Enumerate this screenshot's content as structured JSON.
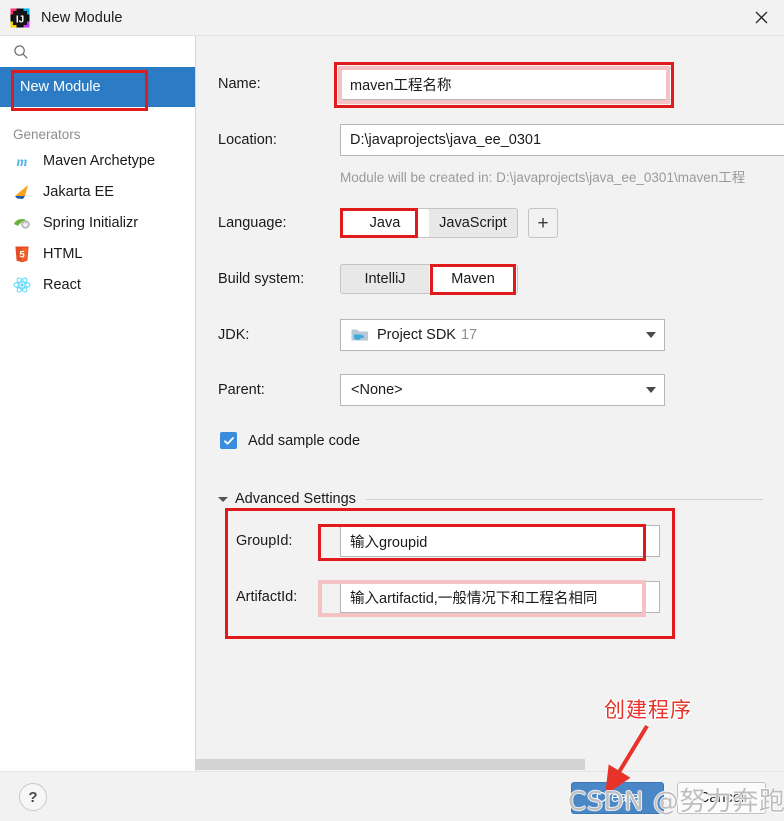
{
  "window": {
    "title": "New Module",
    "app_icon": "intellij-idea-icon",
    "close_icon": "close-icon"
  },
  "sidebar": {
    "search_placeholder": "",
    "search_icon": "search-icon",
    "nav": [
      {
        "label": "New Module",
        "selected": true
      }
    ],
    "generators_label": "Generators",
    "generators": [
      {
        "label": "Maven Archetype",
        "icon": "maven-icon"
      },
      {
        "label": "Jakarta EE",
        "icon": "jakarta-ee-icon"
      },
      {
        "label": "Spring Initializr",
        "icon": "spring-icon"
      },
      {
        "label": "HTML",
        "icon": "html5-icon"
      },
      {
        "label": "React",
        "icon": "react-icon"
      }
    ]
  },
  "form": {
    "name": {
      "label": "Name:",
      "value": "maven工程名称"
    },
    "location": {
      "label": "Location:",
      "value": "D:\\javaprojects\\java_ee_0301",
      "hint": "Module will be created in: D:\\javaprojects\\java_ee_0301\\maven工程"
    },
    "language": {
      "label": "Language:",
      "options": [
        "Java",
        "JavaScript"
      ],
      "selected": "Java",
      "add_label": "+"
    },
    "build_system": {
      "label": "Build system:",
      "options": [
        "IntelliJ",
        "Maven"
      ],
      "selected": "Maven"
    },
    "jdk": {
      "label": "JDK:",
      "value": "Project SDK",
      "version": "17",
      "icon": "jdk-folder-icon"
    },
    "parent": {
      "label": "Parent:",
      "value": "<None>"
    },
    "sample_code": {
      "label": "Add sample code",
      "checked": true
    },
    "advanced": {
      "title": "Advanced Settings",
      "expanded": true,
      "group_id": {
        "label": "GroupId:",
        "value": "输入groupid"
      },
      "artifact_id": {
        "label": "ArtifactId:",
        "value": "输入artifactid,一般情况下和工程名相同"
      }
    }
  },
  "footer": {
    "help_label": "?",
    "create_label": "Create",
    "cancel_label": "Cancel"
  },
  "annotations": {
    "create_note": "创建程序",
    "accent_color": "#e01b1b"
  },
  "watermark": {
    "text": "CSDN @努力奔跑的鱼"
  }
}
